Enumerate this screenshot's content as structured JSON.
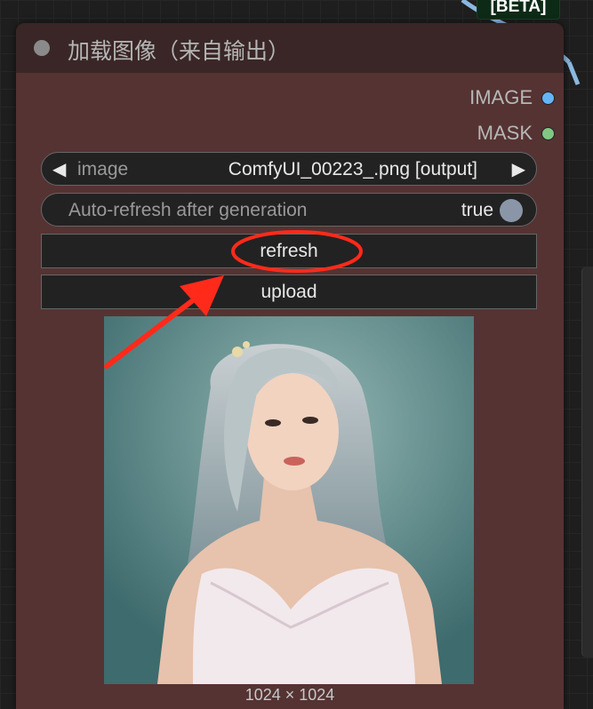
{
  "node": {
    "title": "加载图像（来自输出）",
    "outputs": [
      {
        "label": "IMAGE",
        "color": "#64b5f6"
      },
      {
        "label": "MASK",
        "color": "#81c784"
      }
    ],
    "widgets": {
      "image_combo": {
        "name": "image",
        "value": "ComfyUI_00223_.png [output]"
      },
      "auto_refresh": {
        "name": "Auto-refresh after generation",
        "value": "true"
      },
      "refresh_label": "refresh",
      "upload_label": "upload"
    },
    "preview": {
      "dimensions": "1024 × 1024"
    }
  },
  "background": {
    "beta_label": "[BETA]"
  },
  "annotation": {
    "highlight_color": "#ff2a1a"
  }
}
